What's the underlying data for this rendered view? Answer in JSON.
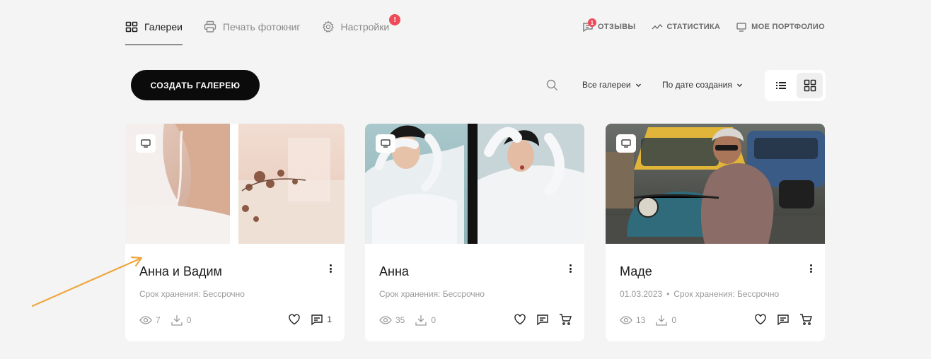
{
  "nav": {
    "tabs": [
      {
        "label": "Галереи",
        "icon": "grid-icon",
        "active": true
      },
      {
        "label": "Печать фотокниг",
        "icon": "printer-icon"
      },
      {
        "label": "Настройки",
        "icon": "gear-icon",
        "alert": "!"
      }
    ],
    "right": [
      {
        "label": "ОТЗЫВЫ",
        "icon": "comments-icon",
        "badge": "1"
      },
      {
        "label": "СТАТИСТИКА",
        "icon": "chart-icon"
      },
      {
        "label": "МОЕ ПОРТФОЛИО",
        "icon": "monitor-icon"
      }
    ]
  },
  "toolbar": {
    "create_label": "СОЗДАТЬ ГАЛЕРЕЮ",
    "filter_label": "Все галереи",
    "sort_label": "По дате создания",
    "view_modes": [
      "list",
      "grid"
    ],
    "active_view": "grid"
  },
  "galleries": [
    {
      "title": "Анна и Вадим",
      "date": "",
      "storage": "Срок хранения: Бессрочно",
      "views": "7",
      "downloads": "0",
      "comments": "1"
    },
    {
      "title": "Анна",
      "date": "",
      "storage": "Срок хранения: Бессрочно",
      "views": "35",
      "downloads": "0",
      "comments": ""
    },
    {
      "title": "Маде",
      "date": "01.03.2023",
      "storage": "Срок хранения: Бессрочно",
      "views": "13",
      "downloads": "0",
      "comments": ""
    }
  ],
  "colors": {
    "accent": "#0b0b0b",
    "alert": "#ef4a5a",
    "annotation_arrow": "#f0a640"
  }
}
